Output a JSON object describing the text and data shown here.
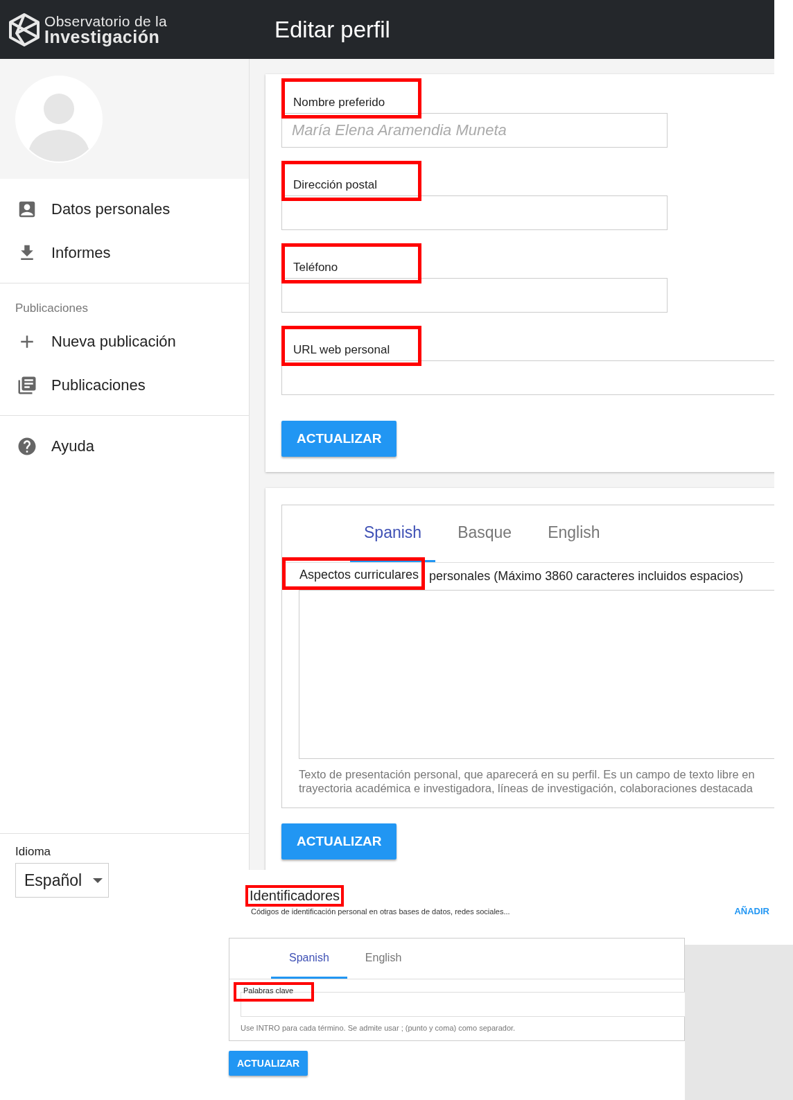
{
  "header": {
    "logo": {
      "line1": "Observatorio de la",
      "line2": "Investigación"
    },
    "title": "Editar perfil"
  },
  "sidebar": {
    "sections": [
      {
        "items": [
          {
            "label": "Datos personales",
            "selected": false
          },
          {
            "label": "Informes",
            "selected": false
          }
        ]
      },
      {
        "subheader": "Publicaciones",
        "items": [
          {
            "label": "Nueva publicación",
            "selected": false
          },
          {
            "label": "Publicaciones",
            "selected": false
          }
        ]
      },
      {
        "items": [
          {
            "label": "Ayuda",
            "selected": false
          }
        ]
      }
    ],
    "language": {
      "label": "Idioma",
      "value": "Español"
    }
  },
  "profile_card": {
    "fields": [
      {
        "kind": "short",
        "label": "Nombre preferido",
        "placeholder": "María Elena Aramendia Muneta",
        "highlighted": true
      },
      {
        "kind": "short",
        "label": "Dirección postal",
        "highlighted": true
      },
      {
        "kind": "short",
        "label": "Teléfono",
        "highlighted": true
      },
      {
        "kind": "wide",
        "label": "URL web personal",
        "highlighted": true
      }
    ],
    "button": "ACTUALIZAR"
  },
  "bio_card": {
    "tabs": [
      {
        "label": "Spanish",
        "selected": true
      },
      {
        "label": "Basque",
        "selected": false
      },
      {
        "label": "English",
        "selected": false
      }
    ],
    "label": {
      "highlighted_part": "Aspectos curriculares",
      "rest": "personales (Máximo 3860 caracteres incluidos espacios)"
    },
    "help_lines": [
      "Texto de presentación personal, que aparecerá en su perfil. Es un campo de texto libre en",
      "trayectoria académica e investigadora, líneas de investigación, colaboraciones destacada"
    ],
    "button": "ACTUALIZAR"
  },
  "identifiers": {
    "title": "Identificadores",
    "highlighted": true,
    "subtitle": "Códigos de identificación personal en otras bases de datos, redes sociales...",
    "action": "AÑADIR"
  },
  "keywords_card": {
    "tabs": [
      {
        "label": "Spanish",
        "selected": true
      },
      {
        "label": "English",
        "selected": false
      }
    ],
    "label": "Palabras clave",
    "highlighted": true,
    "help": "Use INTRO para cada término. Se admite usar ; (punto y coma) como separador.",
    "button": "ACTUALIZAR"
  }
}
